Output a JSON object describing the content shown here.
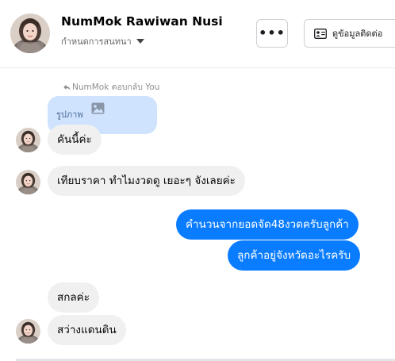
{
  "header": {
    "name": "NumMok Rawiwan Nusi",
    "subtitle": "กำหนดการสนทนา",
    "more_label": "•••",
    "info_label": "ดูข้อมูลติดต่อ",
    "icons": {
      "more": "more-dots-icon",
      "info": "contact-card-icon",
      "caret": "caret-down-icon"
    }
  },
  "thread": {
    "reply_note": "NumMok ตอบกลับ You",
    "quoted_text": "รูปภาพ",
    "messages": [
      {
        "side": "in",
        "text": "คันนี้ค่ะ",
        "avatar": true
      },
      {
        "side": "in",
        "text": "เทียบราคา ทำไมงวดดู เยอะๆ จังเลยค่ะ",
        "avatar": true
      },
      {
        "side": "out",
        "text": "คำนวนจากยอดจัด48งวดครับลูกค้า"
      },
      {
        "side": "out",
        "text": "ลูกค้าอยู่จังหวัดอะไรครับ"
      },
      {
        "side": "in",
        "text": "สกลค่ะ",
        "avatar": false
      },
      {
        "side": "in",
        "text": "สว่างแดนดิน",
        "avatar": true
      }
    ]
  },
  "colors": {
    "outgoing": "#0a7cff",
    "incoming": "#f0f0f0",
    "quoted": "#cfe3ff",
    "secondary_text": "#65676b"
  }
}
